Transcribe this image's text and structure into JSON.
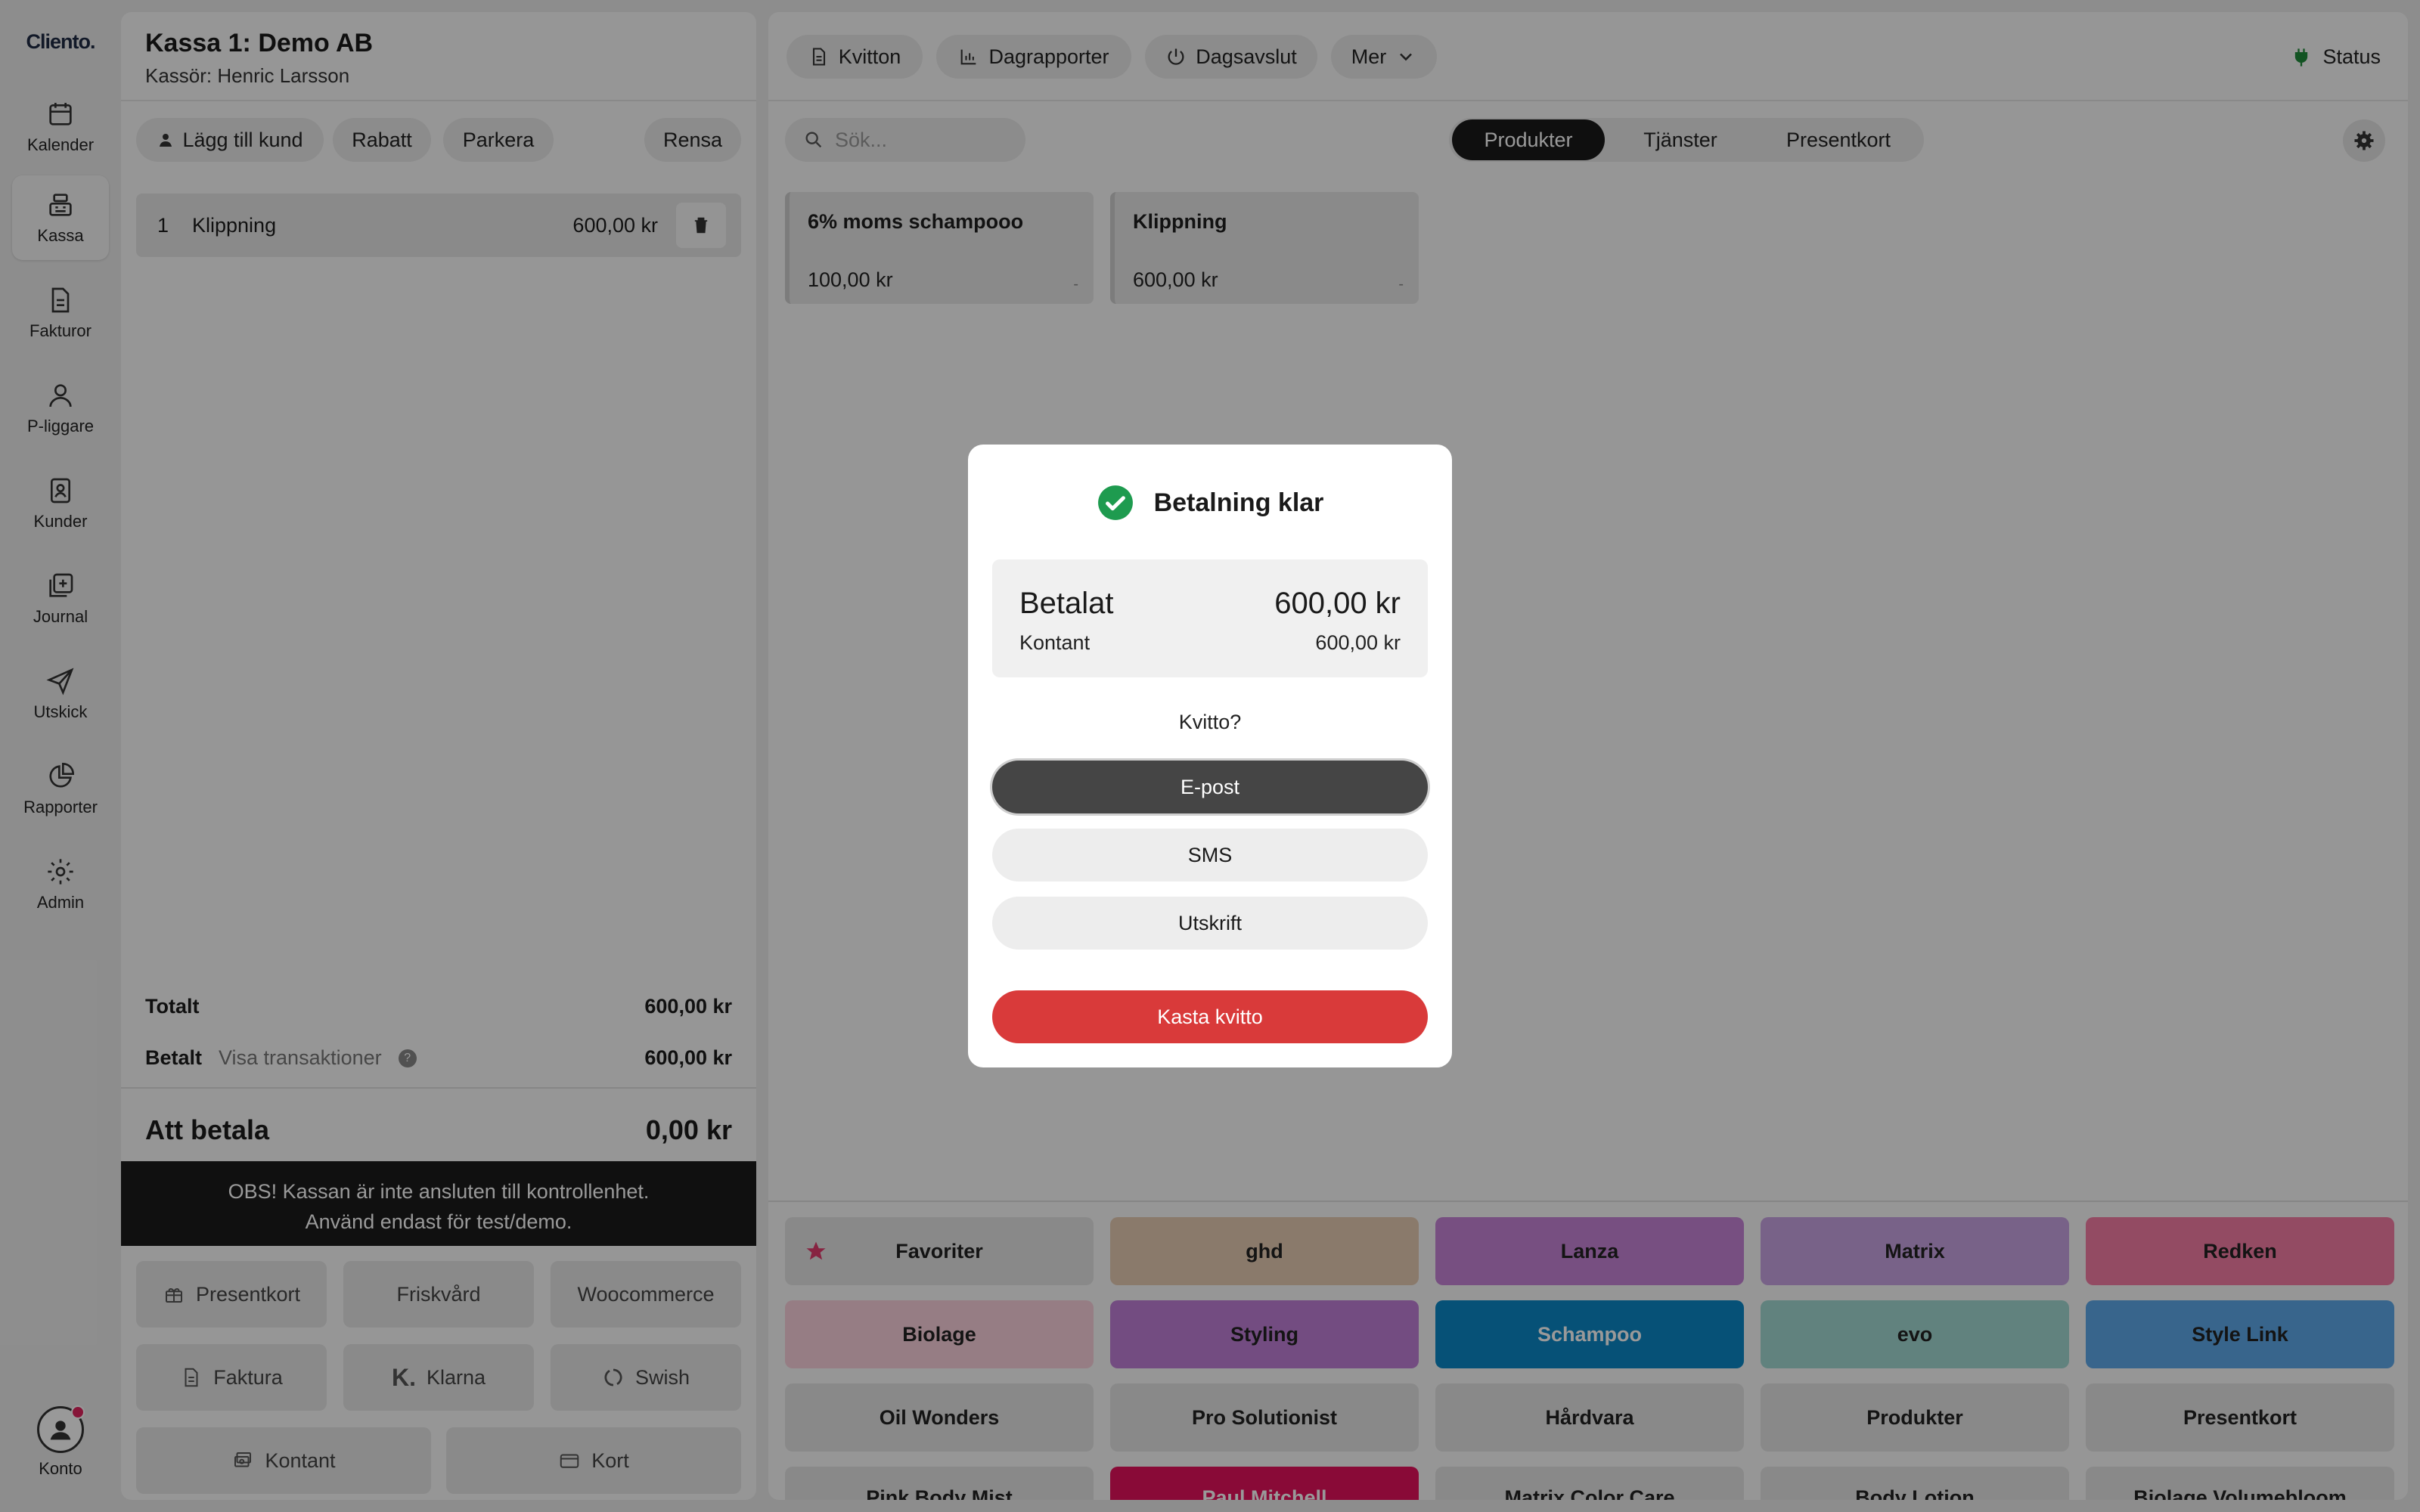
{
  "app": {
    "logo": "Cliento."
  },
  "nav": {
    "items": [
      {
        "label": "Kalender",
        "icon": "calendar-icon"
      },
      {
        "label": "Kassa",
        "icon": "register-icon",
        "active": true
      },
      {
        "label": "Fakturor",
        "icon": "document-icon"
      },
      {
        "label": "P-liggare",
        "icon": "person-icon"
      },
      {
        "label": "Kunder",
        "icon": "contact-card-icon"
      },
      {
        "label": "Journal",
        "icon": "journal-icon"
      },
      {
        "label": "Utskick",
        "icon": "send-icon"
      },
      {
        "label": "Rapporter",
        "icon": "pie-chart-icon"
      },
      {
        "label": "Admin",
        "icon": "gear-icon"
      }
    ],
    "account_label": "Konto"
  },
  "cart": {
    "title": "Kassa 1: Demo AB",
    "cashier": "Kassör: Henric Larsson",
    "actions": {
      "add_customer": "Lägg till kund",
      "discount": "Rabatt",
      "park": "Parkera",
      "clear": "Rensa"
    },
    "line": {
      "qty": "1",
      "name": "Klippning",
      "price": "600,00 kr"
    },
    "total_label": "Totalt",
    "total_value": "600,00 kr",
    "paid_label": "Betalt",
    "show_transactions": "Visa transaktioner",
    "paid_value": "600,00 kr",
    "to_pay_label": "Att betala",
    "to_pay_value": "0,00 kr",
    "notice_line1": "OBS! Kassan är inte ansluten till kontrollenhet.",
    "notice_line2": "Använd endast för test/demo.",
    "payment_methods": {
      "giftcard": "Presentkort",
      "wellness": "Friskvård",
      "woocommerce": "Woocommerce",
      "invoice": "Faktura",
      "klarna": "Klarna",
      "swish": "Swish",
      "cash": "Kontant",
      "card": "Kort"
    }
  },
  "toolbar": {
    "receipts": "Kvitton",
    "daily_reports": "Dagrapporter",
    "day_close": "Dagsavslut",
    "more": "Mer",
    "status": "Status"
  },
  "search": {
    "placeholder": "Sök..."
  },
  "tabs": {
    "products": "Produkter",
    "services": "Tjänster",
    "giftcards": "Presentkort",
    "active": "Produkter"
  },
  "product_tiles": [
    {
      "name": "6% moms schampooo",
      "price": "100,00 kr",
      "stock": "-"
    },
    {
      "name": "Klippning",
      "price": "600,00 kr",
      "stock": "-"
    }
  ],
  "categories": [
    {
      "label": "Favoriter",
      "color": "#e4e4e4"
    },
    {
      "label": "ghd",
      "color": "#e7cbb3"
    },
    {
      "label": "Lanza",
      "color": "#c684d8"
    },
    {
      "label": "Matrix",
      "color": "#c9a3e3"
    },
    {
      "label": "Redken",
      "color": "#f57da5"
    },
    {
      "label": "Biolage",
      "color": "#fbd0dc"
    },
    {
      "label": "Styling",
      "color": "#c07fd8"
    },
    {
      "label": "Schampoo",
      "color": "#0b87c7"
    },
    {
      "label": "evo",
      "color": "#a2d9d2"
    },
    {
      "label": "Style Link",
      "color": "#5ea8ea"
    },
    {
      "label": "Oil Wonders",
      "color": "#e4e4e4"
    },
    {
      "label": "Pro Solutionist",
      "color": "#e4e4e4"
    },
    {
      "label": "Hårdvara",
      "color": "#e4e4e4"
    },
    {
      "label": "Produkter",
      "color": "#e4e4e4"
    },
    {
      "label": "Presentkort",
      "color": "#e4e4e4"
    },
    {
      "label": "Pink Body Mist",
      "color": "#e4e4e4"
    },
    {
      "label": "Paul Mitchell",
      "color": "#e4125c"
    },
    {
      "label": "Matrix Color Care",
      "color": "#e4e4e4"
    },
    {
      "label": "Body Lotion",
      "color": "#e4e4e4"
    },
    {
      "label": "Biolage Volumebloom",
      "color": "#e4e4e4"
    }
  ],
  "modal": {
    "title": "Betalning klar",
    "paid_label": "Betalat",
    "paid_amount": "600,00 kr",
    "method": "Kontant",
    "method_amount": "600,00 kr",
    "receipt_question": "Kvitto?",
    "options": {
      "email": "E-post",
      "sms": "SMS",
      "print": "Utskrift"
    },
    "discard": "Kasta kvitto"
  },
  "colors": {
    "success": "#1e9b4f",
    "danger": "#d93a3a",
    "status_plug": "#1e8a3a"
  }
}
